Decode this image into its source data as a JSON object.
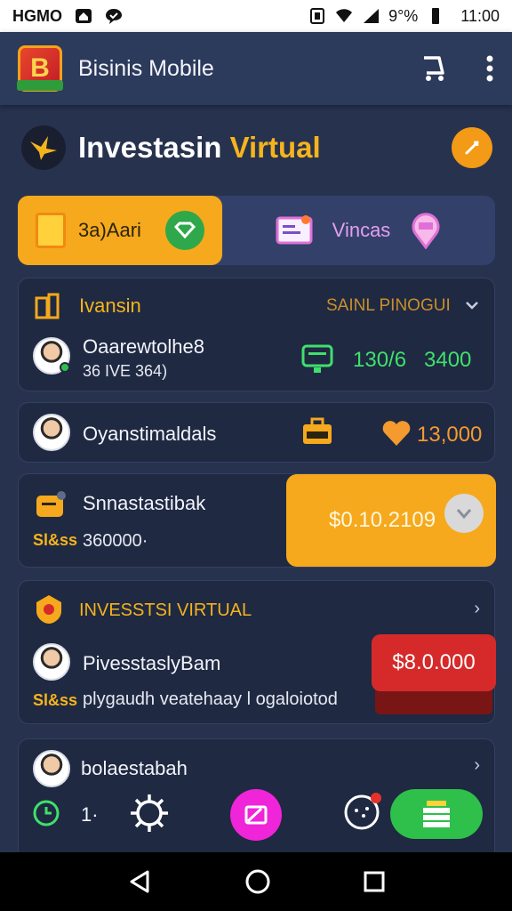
{
  "status_bar": {
    "carrier": "HGMO",
    "battery": "9°%",
    "time": "11:00"
  },
  "app_bar": {
    "title": "Bisinis Mobile",
    "logo_letter": "B"
  },
  "hero": {
    "title_part1": "Investasin",
    "title_part2": "Virtual"
  },
  "tabs": [
    {
      "label": "3a)Aari",
      "active": true
    },
    {
      "label": "Vincas",
      "active": false
    }
  ],
  "card1": {
    "header_left": "Ivansin",
    "header_right": "SAINL PINOGUI",
    "person_name": "Oaarewtolhe8",
    "person_sub": "36 IVE 364)",
    "value1": "130/6",
    "value2": "3400"
  },
  "card2": {
    "person_name": "Oyanstimaldals",
    "value": "13,000"
  },
  "card3": {
    "title": "Snnastastibak",
    "sub_prefix": "Sl&ss",
    "sub_value": "360000·",
    "amount": "$0.10.2109"
  },
  "card4": {
    "header": "INVESSTSI VIRTUAL",
    "person_name": "PivesstaslyBam",
    "sub_prefix": "Sl&ss",
    "sub_text": "plygaudh veatehaay l ogaloiotod",
    "amount": "$8.0.000"
  },
  "card5": {
    "person_name": "bolaestabah",
    "counter": "1·"
  },
  "colors": {
    "accent_orange": "#f6a91c",
    "accent_gold": "#f6b41c",
    "positive_green": "#3fe06b",
    "danger_red": "#d62a2a",
    "background": "#27324f"
  }
}
